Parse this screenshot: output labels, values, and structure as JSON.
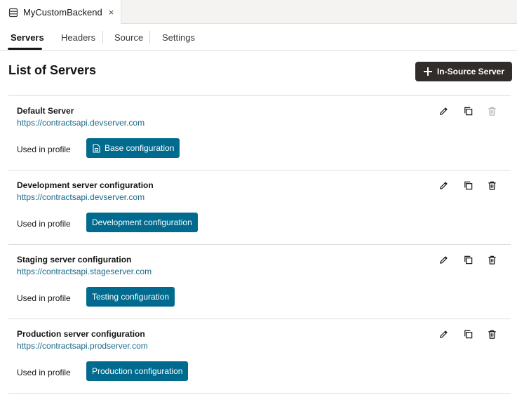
{
  "editor_tab": {
    "title": "MyCustomBackend",
    "close_glyph": "×",
    "icon": "database-icon"
  },
  "subtabs": [
    {
      "label": "Servers",
      "active": true
    },
    {
      "label": "Headers",
      "active": false
    },
    {
      "label": "Source",
      "active": false
    },
    {
      "label": "Settings",
      "active": false
    }
  ],
  "page": {
    "title": "List of Servers",
    "add_button_label": "In-Source Server"
  },
  "colors": {
    "accent": "#006b8f",
    "link": "#1a6a8a",
    "dark_button": "#312d2a"
  },
  "servers": [
    {
      "name": "Default Server",
      "url": "https://contractsapi.devserver.com",
      "used_label": "Used in profile",
      "profile": "Base configuration",
      "profile_icon": "document-icon",
      "delete_enabled": false
    },
    {
      "name": "Development server configuration",
      "url": "https://contractsapi.devserver.com",
      "used_label": "Used in profile",
      "profile": "Development configuration",
      "delete_enabled": true
    },
    {
      "name": "Staging server configuration",
      "url": "https://contractsapi.stageserver.com",
      "used_label": "Used in profile",
      "profile": "Testing configuration",
      "delete_enabled": true
    },
    {
      "name": "Production server configuration",
      "url": "https://contractsapi.prodserver.com",
      "used_label": "Used in profile",
      "profile": "Production configuration",
      "delete_enabled": true
    }
  ]
}
